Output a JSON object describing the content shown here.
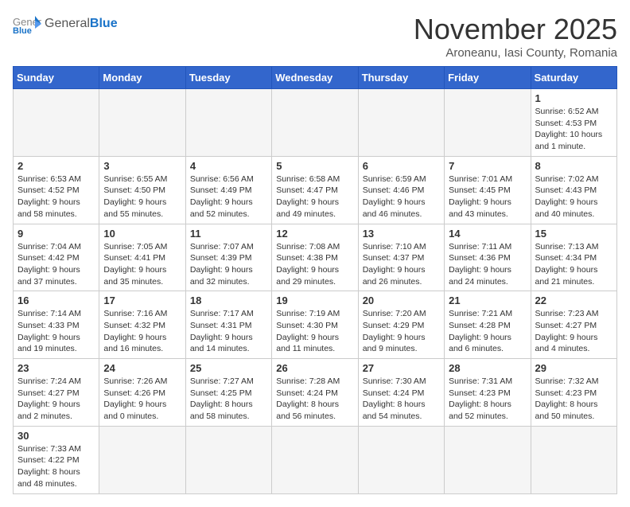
{
  "header": {
    "logo_general": "General",
    "logo_blue": "Blue",
    "month": "November 2025",
    "location": "Aroneanu, Iasi County, Romania"
  },
  "weekdays": [
    "Sunday",
    "Monday",
    "Tuesday",
    "Wednesday",
    "Thursday",
    "Friday",
    "Saturday"
  ],
  "weeks": [
    [
      {
        "day": "",
        "info": ""
      },
      {
        "day": "",
        "info": ""
      },
      {
        "day": "",
        "info": ""
      },
      {
        "day": "",
        "info": ""
      },
      {
        "day": "",
        "info": ""
      },
      {
        "day": "",
        "info": ""
      },
      {
        "day": "1",
        "info": "Sunrise: 6:52 AM\nSunset: 4:53 PM\nDaylight: 10 hours and 1 minute."
      }
    ],
    [
      {
        "day": "2",
        "info": "Sunrise: 6:53 AM\nSunset: 4:52 PM\nDaylight: 9 hours and 58 minutes."
      },
      {
        "day": "3",
        "info": "Sunrise: 6:55 AM\nSunset: 4:50 PM\nDaylight: 9 hours and 55 minutes."
      },
      {
        "day": "4",
        "info": "Sunrise: 6:56 AM\nSunset: 4:49 PM\nDaylight: 9 hours and 52 minutes."
      },
      {
        "day": "5",
        "info": "Sunrise: 6:58 AM\nSunset: 4:47 PM\nDaylight: 9 hours and 49 minutes."
      },
      {
        "day": "6",
        "info": "Sunrise: 6:59 AM\nSunset: 4:46 PM\nDaylight: 9 hours and 46 minutes."
      },
      {
        "day": "7",
        "info": "Sunrise: 7:01 AM\nSunset: 4:45 PM\nDaylight: 9 hours and 43 minutes."
      },
      {
        "day": "8",
        "info": "Sunrise: 7:02 AM\nSunset: 4:43 PM\nDaylight: 9 hours and 40 minutes."
      }
    ],
    [
      {
        "day": "9",
        "info": "Sunrise: 7:04 AM\nSunset: 4:42 PM\nDaylight: 9 hours and 37 minutes."
      },
      {
        "day": "10",
        "info": "Sunrise: 7:05 AM\nSunset: 4:41 PM\nDaylight: 9 hours and 35 minutes."
      },
      {
        "day": "11",
        "info": "Sunrise: 7:07 AM\nSunset: 4:39 PM\nDaylight: 9 hours and 32 minutes."
      },
      {
        "day": "12",
        "info": "Sunrise: 7:08 AM\nSunset: 4:38 PM\nDaylight: 9 hours and 29 minutes."
      },
      {
        "day": "13",
        "info": "Sunrise: 7:10 AM\nSunset: 4:37 PM\nDaylight: 9 hours and 26 minutes."
      },
      {
        "day": "14",
        "info": "Sunrise: 7:11 AM\nSunset: 4:36 PM\nDaylight: 9 hours and 24 minutes."
      },
      {
        "day": "15",
        "info": "Sunrise: 7:13 AM\nSunset: 4:34 PM\nDaylight: 9 hours and 21 minutes."
      }
    ],
    [
      {
        "day": "16",
        "info": "Sunrise: 7:14 AM\nSunset: 4:33 PM\nDaylight: 9 hours and 19 minutes."
      },
      {
        "day": "17",
        "info": "Sunrise: 7:16 AM\nSunset: 4:32 PM\nDaylight: 9 hours and 16 minutes."
      },
      {
        "day": "18",
        "info": "Sunrise: 7:17 AM\nSunset: 4:31 PM\nDaylight: 9 hours and 14 minutes."
      },
      {
        "day": "19",
        "info": "Sunrise: 7:19 AM\nSunset: 4:30 PM\nDaylight: 9 hours and 11 minutes."
      },
      {
        "day": "20",
        "info": "Sunrise: 7:20 AM\nSunset: 4:29 PM\nDaylight: 9 hours and 9 minutes."
      },
      {
        "day": "21",
        "info": "Sunrise: 7:21 AM\nSunset: 4:28 PM\nDaylight: 9 hours and 6 minutes."
      },
      {
        "day": "22",
        "info": "Sunrise: 7:23 AM\nSunset: 4:27 PM\nDaylight: 9 hours and 4 minutes."
      }
    ],
    [
      {
        "day": "23",
        "info": "Sunrise: 7:24 AM\nSunset: 4:27 PM\nDaylight: 9 hours and 2 minutes."
      },
      {
        "day": "24",
        "info": "Sunrise: 7:26 AM\nSunset: 4:26 PM\nDaylight: 9 hours and 0 minutes."
      },
      {
        "day": "25",
        "info": "Sunrise: 7:27 AM\nSunset: 4:25 PM\nDaylight: 8 hours and 58 minutes."
      },
      {
        "day": "26",
        "info": "Sunrise: 7:28 AM\nSunset: 4:24 PM\nDaylight: 8 hours and 56 minutes."
      },
      {
        "day": "27",
        "info": "Sunrise: 7:30 AM\nSunset: 4:24 PM\nDaylight: 8 hours and 54 minutes."
      },
      {
        "day": "28",
        "info": "Sunrise: 7:31 AM\nSunset: 4:23 PM\nDaylight: 8 hours and 52 minutes."
      },
      {
        "day": "29",
        "info": "Sunrise: 7:32 AM\nSunset: 4:23 PM\nDaylight: 8 hours and 50 minutes."
      }
    ],
    [
      {
        "day": "30",
        "info": "Sunrise: 7:33 AM\nSunset: 4:22 PM\nDaylight: 8 hours and 48 minutes."
      },
      {
        "day": "",
        "info": ""
      },
      {
        "day": "",
        "info": ""
      },
      {
        "day": "",
        "info": ""
      },
      {
        "day": "",
        "info": ""
      },
      {
        "day": "",
        "info": ""
      },
      {
        "day": "",
        "info": ""
      }
    ]
  ]
}
